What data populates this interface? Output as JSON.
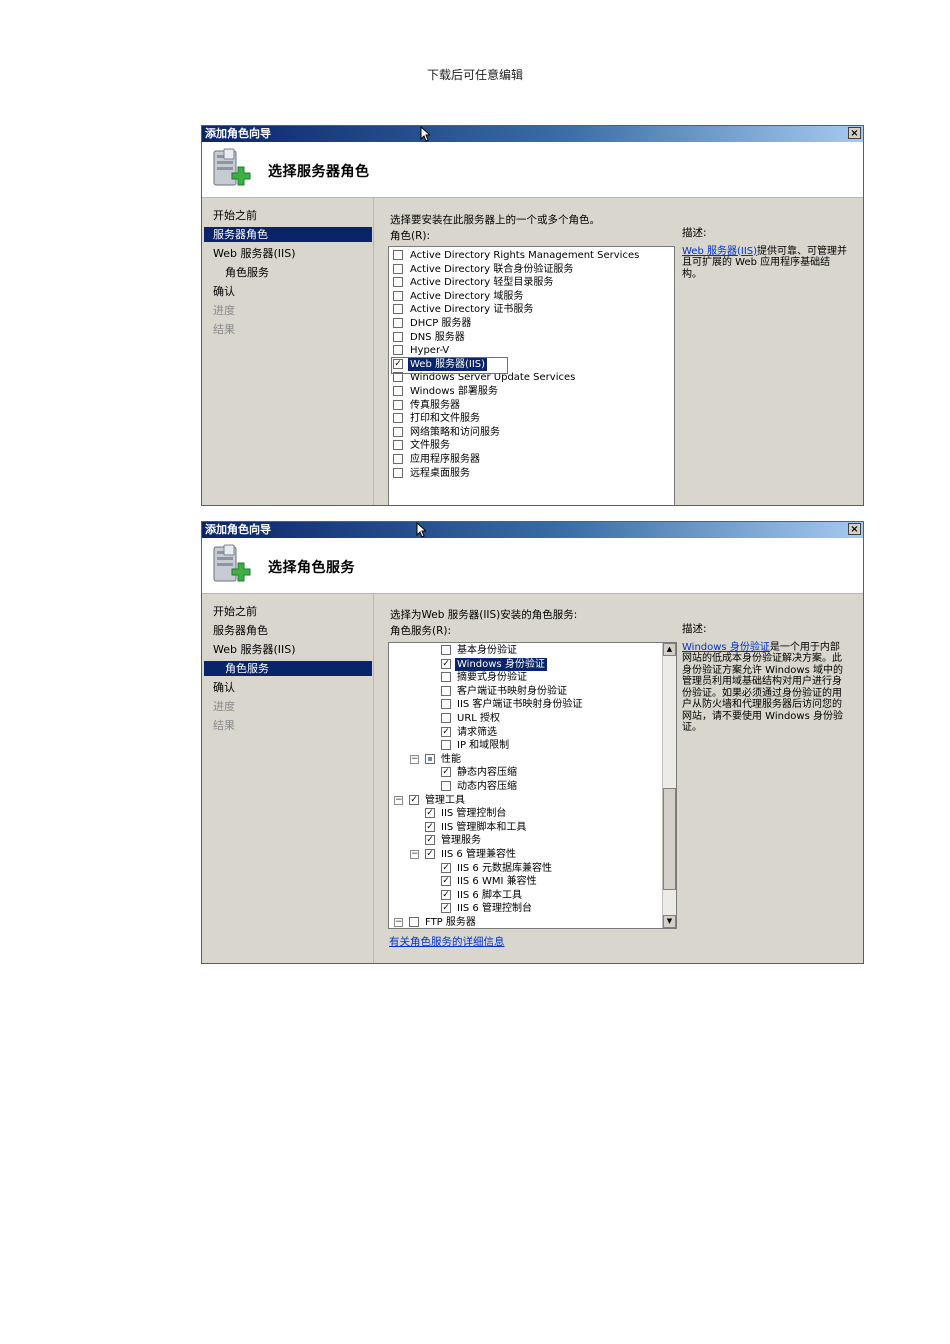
{
  "page_header": "下载后可任意编辑",
  "window1": {
    "title": "添加角色向导",
    "close_symbol": "×",
    "banner_title": "选择服务器角色",
    "nav": [
      "开始之前",
      "服务器角色",
      "Web 服务器(IIS)",
      "角色服务",
      "确认",
      "进度",
      "结果"
    ],
    "instruction": "选择要安装在此服务器上的一个或多个角色。",
    "list_label": "角色(R):",
    "roles": [
      {
        "label": "Active Directory Rights Management Services",
        "checked": false
      },
      {
        "label": "Active Directory 联合身份验证服务",
        "checked": false
      },
      {
        "label": "Active Directory 轻型目录服务",
        "checked": false
      },
      {
        "label": "Active Directory 域服务",
        "checked": false
      },
      {
        "label": "Active Directory 证书服务",
        "checked": false
      },
      {
        "label": "DHCP 服务器",
        "checked": false
      },
      {
        "label": "DNS 服务器",
        "checked": false
      },
      {
        "label": "Hyper-V",
        "checked": false
      },
      {
        "label": "Web 服务器(IIS)",
        "checked": true,
        "selected": true
      },
      {
        "label": "Windows Server Update Services",
        "checked": false
      },
      {
        "label": "Windows 部署服务",
        "checked": false
      },
      {
        "label": "传真服务器",
        "checked": false
      },
      {
        "label": "打印和文件服务",
        "checked": false
      },
      {
        "label": "网络策略和访问服务",
        "checked": false
      },
      {
        "label": "文件服务",
        "checked": false
      },
      {
        "label": "应用程序服务器",
        "checked": false
      },
      {
        "label": "远程桌面服务",
        "checked": false
      }
    ],
    "desc_title": "描述:",
    "desc_link": "Web 服务器(IIS)",
    "desc_text": "提供可靠、可管理并且可扩展的 Web 应用程序基础结构。"
  },
  "window2": {
    "title": "添加角色向导",
    "close_symbol": "×",
    "banner_title": "选择角色服务",
    "nav": [
      "开始之前",
      "服务器角色",
      "Web 服务器(IIS)",
      "角色服务",
      "确认",
      "进度",
      "结果"
    ],
    "instruction": "选择为Web 服务器(IIS)安装的角色服务:",
    "list_label": "角色服务(R):",
    "services": [
      {
        "label": "基本身份验证",
        "state": "unchecked",
        "level": 3
      },
      {
        "label": "Windows 身份验证",
        "state": "checked",
        "level": 3,
        "selected": true
      },
      {
        "label": "摘要式身份验证",
        "state": "unchecked",
        "level": 3
      },
      {
        "label": "客户端证书映射身份验证",
        "state": "unchecked",
        "level": 3
      },
      {
        "label": "IIS 客户端证书映射身份验证",
        "state": "unchecked",
        "level": 3
      },
      {
        "label": "URL 授权",
        "state": "unchecked",
        "level": 3
      },
      {
        "label": "请求筛选",
        "state": "checked",
        "level": 3
      },
      {
        "label": "IP 和域限制",
        "state": "unchecked",
        "level": 3
      },
      {
        "label": "性能",
        "state": "partial",
        "level": 2,
        "expander": "⊟"
      },
      {
        "label": "静态内容压缩",
        "state": "checked",
        "level": 3
      },
      {
        "label": "动态内容压缩",
        "state": "unchecked",
        "level": 3
      },
      {
        "label": "管理工具",
        "state": "checked",
        "level": 1,
        "expander": "⊟"
      },
      {
        "label": "IIS 管理控制台",
        "state": "checked",
        "level": 2
      },
      {
        "label": "IIS 管理脚本和工具",
        "state": "checked",
        "level": 2
      },
      {
        "label": "管理服务",
        "state": "checked",
        "level": 2
      },
      {
        "label": "IIS 6 管理兼容性",
        "state": "checked",
        "level": 2,
        "expander": "⊟"
      },
      {
        "label": "IIS 6 元数据库兼容性",
        "state": "checked",
        "level": 3
      },
      {
        "label": "IIS 6 WMI 兼容性",
        "state": "checked",
        "level": 3
      },
      {
        "label": "IIS 6 脚本工具",
        "state": "checked",
        "level": 3
      },
      {
        "label": "IIS 6 管理控制台",
        "state": "checked",
        "level": 3
      },
      {
        "label": "FTP 服务器",
        "state": "unchecked",
        "level": 1,
        "expander": "⊟"
      }
    ],
    "scroll_up": "▲",
    "scroll_down": "▼",
    "more_link": "有关角色服务的详细信息",
    "desc_title": "描述:",
    "desc_link": "Windows 身份验证",
    "desc_text": "是一个用于内部网站的低成本身份验证解决方案。此身份验证方案允许 Windows 域中的管理员利用域基础结构对用户进行身份验证。如果必须通过身份验证的用户从防火墙和代理服务器后访问您的网站，请不要使用 Windows 身份验证。"
  },
  "colors": {
    "title_bar": "#0a246a",
    "selection": "#0a246a",
    "highlight_box": "#e04040",
    "link": "#0033cc"
  }
}
